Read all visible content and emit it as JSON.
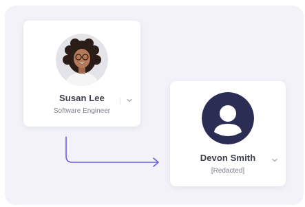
{
  "nodes": [
    {
      "name": "Susan Lee",
      "role": "Software Engineer",
      "avatar": "photo-avatar"
    },
    {
      "name": "Devon Smith",
      "role": "[Redacted]",
      "avatar": "default-user-icon"
    }
  ],
  "colors": {
    "canvas_bg": "#f2f2f8",
    "card_bg": "#ffffff",
    "connector": "#6b5ce7",
    "default_avatar_bg": "#2b2d55",
    "name_text": "#3b3e4a",
    "role_text": "#7a7d88"
  }
}
